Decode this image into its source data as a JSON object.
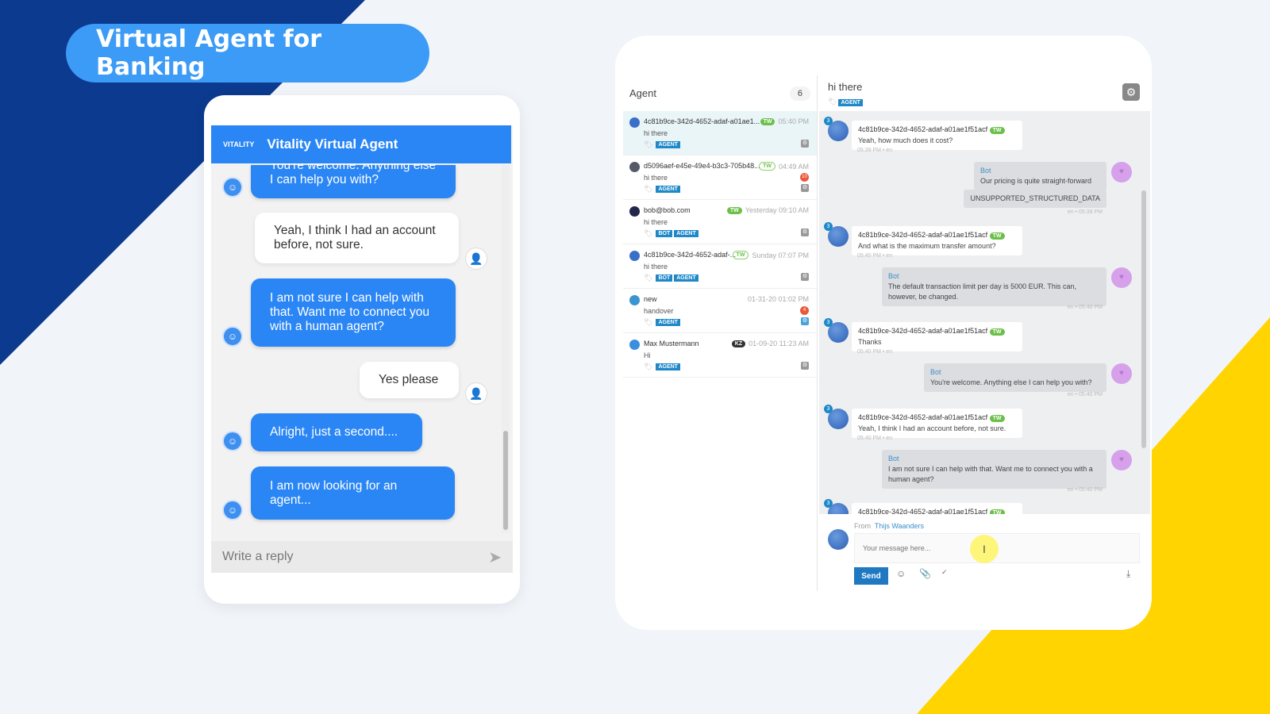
{
  "banner": {
    "title": "Virtual Agent for Banking"
  },
  "colors": {
    "navy": "#0b3a8f",
    "yellow": "#ffd400",
    "accent": "#2b86f5",
    "tag": "#1e88c8",
    "tw_green": "#6cc04a"
  },
  "widget": {
    "brand": "VITALITY",
    "title": "Vitality Virtual Agent",
    "messages": [
      {
        "from": "bot",
        "text": "You're welcome. Anything else I can help you with?"
      },
      {
        "from": "user",
        "text": "Yeah, I think I had an account before, not sure."
      },
      {
        "from": "bot",
        "text": "I am not sure I can help with that. Want me to connect you with a human agent?"
      },
      {
        "from": "user",
        "text": "Yes please"
      },
      {
        "from": "bot",
        "text": "Alright, just a second...."
      },
      {
        "from": "bot",
        "text": "I am now looking for an agent..."
      }
    ],
    "reply_placeholder": "Write a reply"
  },
  "inbox": {
    "title": "Agent",
    "count": "6",
    "conversations": [
      {
        "name": "4c81b9ce-342d-4652-adaf-a01ae1...",
        "channel": "TW",
        "channel_style": "fill",
        "time": "05:40 PM",
        "preview": "hi there",
        "tags": [
          "AGENT"
        ],
        "dot": "#3a6fc8",
        "selected": true
      },
      {
        "name": "d5096aef-e45e-49e4-b3c3-705b48...",
        "channel": "TW",
        "channel_style": "out",
        "time": "04:49 AM",
        "preview": "hi there",
        "tags": [
          "AGENT"
        ],
        "dot": "#555a66",
        "unread": "10"
      },
      {
        "name": "bob@bob.com",
        "channel": "TW",
        "channel_style": "fill",
        "time": "Yesterday 09:10 AM",
        "preview": "hi there",
        "tags": [
          "BOT",
          "AGENT"
        ],
        "dot": "#22264a"
      },
      {
        "name": "4c81b9ce-342d-4652-adaf-...",
        "channel": "TW",
        "channel_style": "out",
        "time": "Sunday 07:07 PM",
        "preview": "hi there",
        "tags": [
          "BOT",
          "AGENT"
        ],
        "dot": "#3a6fc8"
      },
      {
        "name": "new",
        "channel": "",
        "channel_style": "",
        "time": "01-31-20 01:02 PM",
        "preview": "handover",
        "tags": [
          "AGENT"
        ],
        "dot": "#3a94d0",
        "unread": "4"
      },
      {
        "name": "Max Mustermann",
        "channel": "KZ",
        "channel_style": "dark",
        "time": "01-09-20 11:23 AM",
        "preview": "Hi",
        "tags": [
          "AGENT"
        ],
        "dot": "#3a8ee0"
      }
    ]
  },
  "conversation": {
    "title": "hi there",
    "tag": "AGENT",
    "messages": [
      {
        "from": "user",
        "sender": "4c81b9ce-342d-4652-adaf-a01ae1f51acf",
        "channel": "TW",
        "text": "Yeah, how much does it cost?",
        "meta": "05:39 PM • en",
        "badge": "3"
      },
      {
        "from": "bot",
        "sender": "Bot",
        "text": "Our pricing is quite straight-forward",
        "extra": "UNSUPPORTED_STRUCTURED_DATA",
        "meta": "en • 05:39 PM"
      },
      {
        "from": "user",
        "sender": "4c81b9ce-342d-4652-adaf-a01ae1f51acf",
        "channel": "TW",
        "text": "And what is the maximum transfer amount?",
        "meta": "05:40 PM • en",
        "badge": "3"
      },
      {
        "from": "bot",
        "sender": "Bot",
        "text": "The default transaction limit per day is 5000 EUR. This can, however, be changed.",
        "meta": "en • 05:40 PM"
      },
      {
        "from": "user",
        "sender": "4c81b9ce-342d-4652-adaf-a01ae1f51acf",
        "channel": "TW",
        "text": "Thanks",
        "meta": "05:40 PM • en",
        "badge": "3"
      },
      {
        "from": "bot",
        "sender": "Bot",
        "text": "You're welcome. Anything else I can help you with?",
        "meta": "en • 05:40 PM"
      },
      {
        "from": "user",
        "sender": "4c81b9ce-342d-4652-adaf-a01ae1f51acf",
        "channel": "TW",
        "text": "Yeah, I think I had an account before, not sure.",
        "meta": "05:40 PM • en",
        "badge": "3"
      },
      {
        "from": "bot",
        "sender": "Bot",
        "text": "I am not sure I can help with that. Want me to connect you with a human agent?",
        "meta": "en • 05:40 PM"
      },
      {
        "from": "user",
        "sender": "4c81b9ce-342d-4652-adaf-a01ae1f51acf",
        "channel": "TW",
        "text": "",
        "meta": "",
        "badge": "3"
      }
    ],
    "composer": {
      "from_label": "From",
      "from_name": "Thijs Waanders",
      "placeholder": "Your message here...",
      "send_label": "Send"
    }
  }
}
